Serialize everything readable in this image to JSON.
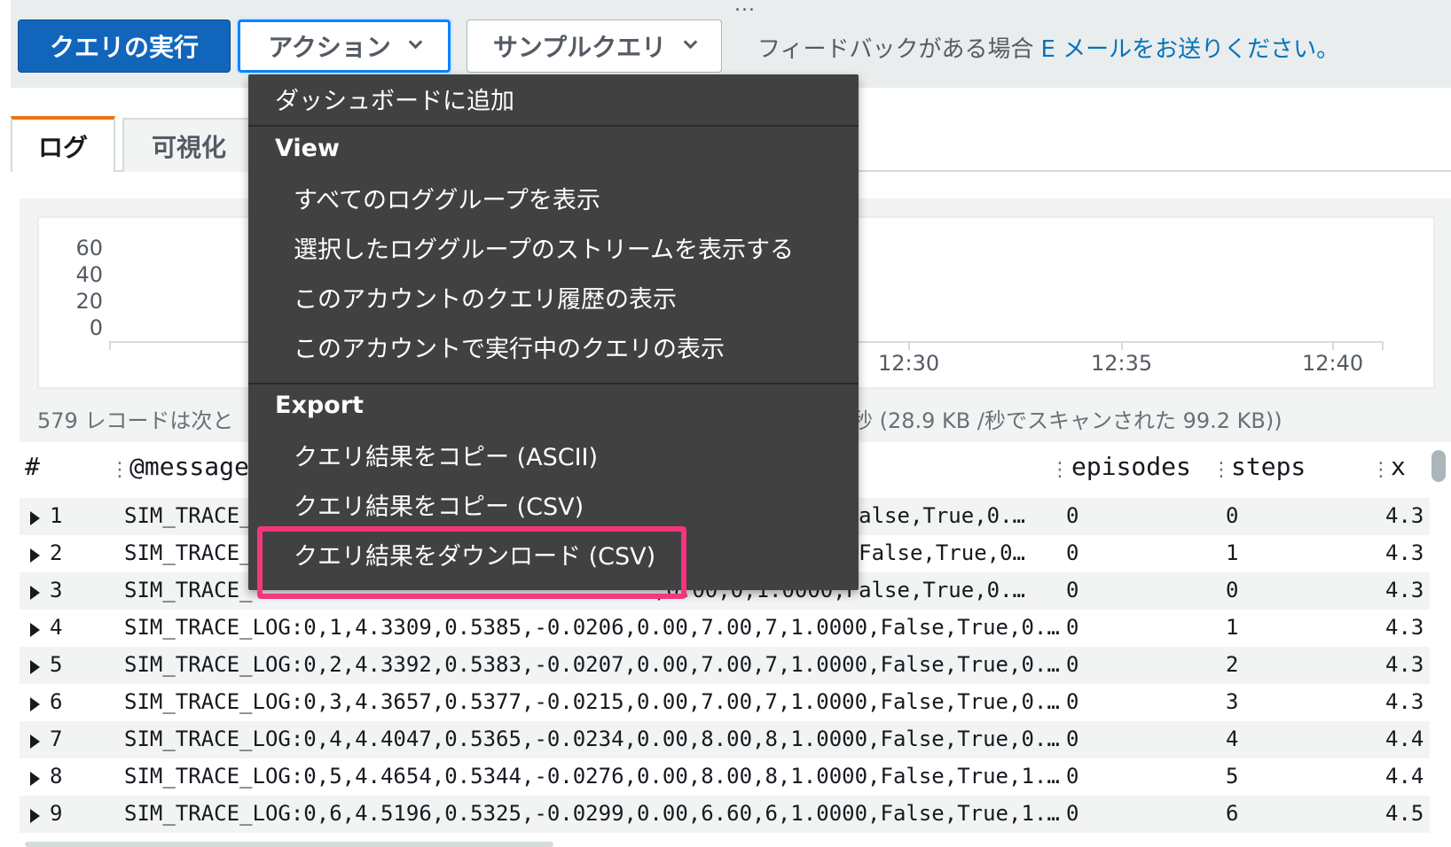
{
  "toolbar": {
    "run_label": "クエリの実行",
    "actions_label": "アクション",
    "samples_label": "サンプルクエリ",
    "feedback_text": "フィードバックがある場合",
    "feedback_link": "E メールをお送りください。",
    "grip": "..."
  },
  "tabs": [
    {
      "label": "ログ"
    },
    {
      "label": "可視化"
    }
  ],
  "histogram": {
    "y_ticks": [
      "60",
      "40",
      "20",
      "0"
    ],
    "x_ticks": [
      "12:30",
      "12:35",
      "12:40"
    ],
    "summary_left": "579 レコードは次と",
    "summary_right": "秒 (28.9 KB /秒でスキャンされた 99.2 KB))"
  },
  "table": {
    "headers": {
      "num": "#",
      "message": "@message",
      "episodes": "episodes",
      "steps": "steps",
      "x": "x"
    },
    "rows": [
      {
        "n": "1",
        "msg_left": "SIM_TRACE_",
        "msg_right": "0,False,True,0.…",
        "episodes": "0",
        "steps": "0",
        "x": "4.3"
      },
      {
        "n": "2",
        "msg_left": "SIM_TRACE_",
        "msg_right": "00,False,True,0…",
        "episodes": "0",
        "steps": "1",
        "x": "4.3"
      },
      {
        "n": "3",
        "msg_left": "SIM_TRACE_",
        "msg_right": ",0.00,0,1.0000,False,True,0.…",
        "episodes": "0",
        "steps": "0",
        "x": "4.3"
      },
      {
        "n": "4",
        "msg": "SIM_TRACE_LOG:0,1,4.3309,0.5385,-0.0206,0.00,7.00,7,1.0000,False,True,0.…",
        "episodes": "0",
        "steps": "1",
        "x": "4.3"
      },
      {
        "n": "5",
        "msg": "SIM_TRACE_LOG:0,2,4.3392,0.5383,-0.0207,0.00,7.00,7,1.0000,False,True,0.…",
        "episodes": "0",
        "steps": "2",
        "x": "4.3"
      },
      {
        "n": "6",
        "msg": "SIM_TRACE_LOG:0,3,4.3657,0.5377,-0.0215,0.00,7.00,7,1.0000,False,True,0.…",
        "episodes": "0",
        "steps": "3",
        "x": "4.3"
      },
      {
        "n": "7",
        "msg": "SIM_TRACE_LOG:0,4,4.4047,0.5365,-0.0234,0.00,8.00,8,1.0000,False,True,0.…",
        "episodes": "0",
        "steps": "4",
        "x": "4.4"
      },
      {
        "n": "8",
        "msg": "SIM_TRACE_LOG:0,5,4.4654,0.5344,-0.0276,0.00,8.00,8,1.0000,False,True,1.…",
        "episodes": "0",
        "steps": "5",
        "x": "4.4"
      },
      {
        "n": "9",
        "msg": "SIM_TRACE_LOG:0,6,4.5196,0.5325,-0.0299,0.00,6.60,6,1.0000,False,True,1.…",
        "episodes": "0",
        "steps": "6",
        "x": "4.5"
      }
    ]
  },
  "menu": {
    "add_dashboard": "ダッシュボードに追加",
    "view_header": "View",
    "view_items": [
      "すべてのロググループを表示",
      "選択したロググループのストリームを表示する",
      "このアカウントのクエリ履歴の表示",
      "このアカウントで実行中のクエリの表示"
    ],
    "export_header": "Export",
    "export_items": [
      "クエリ結果をコピー (ASCII)",
      "クエリ結果をコピー (CSV)",
      "クエリ結果をダウンロード (CSV)"
    ]
  },
  "colors": {
    "primary": "#1166bb",
    "highlight": "#f5357c",
    "tab_accent": "#ec7211",
    "menu_bg": "#414141"
  }
}
